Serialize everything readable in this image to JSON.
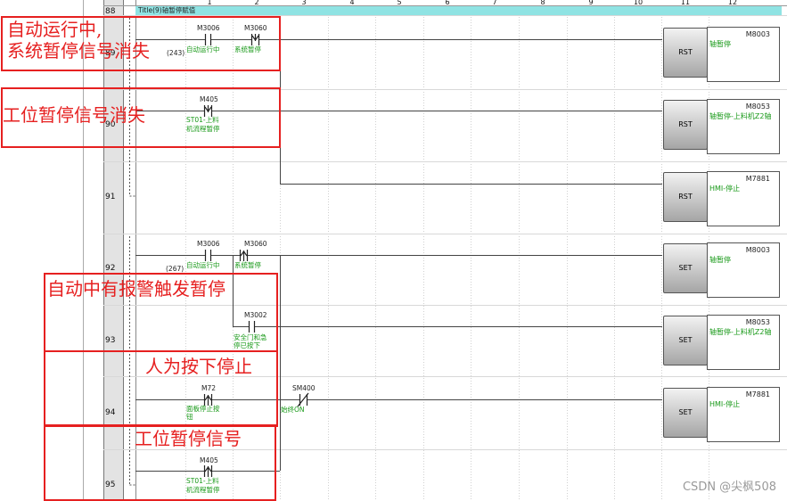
{
  "column_headers": [
    "1",
    "2",
    "3",
    "4",
    "5",
    "6",
    "7",
    "8",
    "9",
    "10",
    "11",
    "12"
  ],
  "title_bar": {
    "text": "Title(9)轴暂停赋值"
  },
  "rows": [
    {
      "num": "88"
    },
    {
      "num": "89"
    },
    {
      "num": "90"
    },
    {
      "num": "91"
    },
    {
      "num": "92"
    },
    {
      "num": "93"
    },
    {
      "num": "94"
    },
    {
      "num": "95"
    }
  ],
  "step_labels": {
    "r89": "(243)",
    "r92": "(267)"
  },
  "contacts": {
    "m3006_a": {
      "device": "M3006",
      "comment": "自动运行中"
    },
    "m3060_a": {
      "device": "M3060",
      "comment": "系统暂停"
    },
    "m405_a": {
      "device": "M405",
      "comment1": "ST01-上料",
      "comment2": "机流程暂停"
    },
    "m3006_b": {
      "device": "M3006",
      "comment": "自动运行中"
    },
    "m3060_b": {
      "device": "M3060",
      "comment": "系统暂停"
    },
    "m3002": {
      "device": "M3002",
      "comment1": "安全门和急",
      "comment2": "停已按下"
    },
    "m72": {
      "device": "M72",
      "comment1": "面板停止按",
      "comment2": "钮"
    },
    "sm400": {
      "device": "SM400",
      "comment": "始终ON"
    },
    "m405_b": {
      "device": "M405",
      "comment1": "ST01-上料",
      "comment2": "机流程暂停"
    }
  },
  "coils": [
    {
      "instr": "RST",
      "device": "M8003",
      "comment": "轴暂停"
    },
    {
      "instr": "RST",
      "device": "M8053",
      "comment": "轴暂停-上料机Z2轴"
    },
    {
      "instr": "RST",
      "device": "M7881",
      "comment": "HMI-停止"
    },
    {
      "instr": "SET",
      "device": "M8003",
      "comment": "轴暂停"
    },
    {
      "instr": "SET",
      "device": "M8053",
      "comment": "轴暂停-上料机Z2轴"
    },
    {
      "instr": "SET",
      "device": "M7881",
      "comment": "HMI-停止"
    }
  ],
  "annotations": {
    "a1_line1": "自动运行中,",
    "a1_line2": "系统暂停信号消失",
    "a2": "工位暂停信号消失",
    "a3": "自动中有报警触发暂停",
    "a4": "人为按下停止",
    "a5": "工位暂停信号"
  },
  "watermark": "CSDN @尖枫508",
  "colors": {
    "annotation": "#e62020",
    "comment": "#1a9a1a",
    "title_bar": "#8fe3e3"
  }
}
